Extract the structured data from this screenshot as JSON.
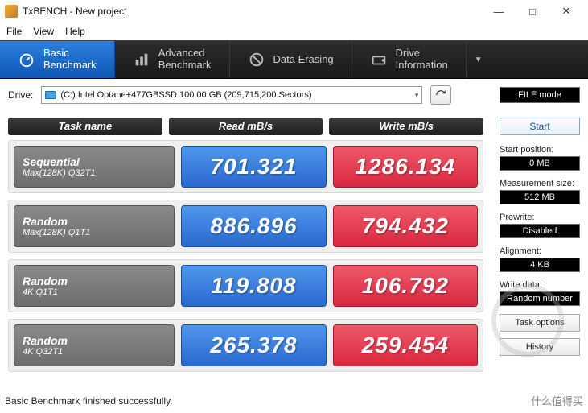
{
  "window": {
    "title": "TxBENCH - New project"
  },
  "menu": {
    "file": "File",
    "view": "View",
    "help": "Help"
  },
  "toolbar": {
    "basic": {
      "l1": "Basic",
      "l2": "Benchmark"
    },
    "advanced": {
      "l1": "Advanced",
      "l2": "Benchmark"
    },
    "erase": {
      "l1": "Data Erasing"
    },
    "info": {
      "l1": "Drive",
      "l2": "Information"
    }
  },
  "drive": {
    "label": "Drive:",
    "selected": "(C:) Intel Optane+477GBSSD  100.00 GB (209,715,200 Sectors)",
    "filemode": "FILE mode"
  },
  "headers": {
    "task": "Task name",
    "read": "Read mB/s",
    "write": "Write mB/s"
  },
  "rows": [
    {
      "t1": "Sequential",
      "t2": "Max(128K) Q32T1",
      "read": "701.321",
      "write": "1286.134"
    },
    {
      "t1": "Random",
      "t2": "Max(128K) Q1T1",
      "read": "886.896",
      "write": "794.432"
    },
    {
      "t1": "Random",
      "t2": "4K Q1T1",
      "read": "119.808",
      "write": "106.792"
    },
    {
      "t1": "Random",
      "t2": "4K Q32T1",
      "read": "265.378",
      "write": "259.454"
    }
  ],
  "side": {
    "start": "Start",
    "startpos_l": "Start position:",
    "startpos_v": "0 MB",
    "meas_l": "Measurement size:",
    "meas_v": "512 MB",
    "prewrite_l": "Prewrite:",
    "prewrite_v": "Disabled",
    "align_l": "Alignment:",
    "align_v": "4 KB",
    "wdata_l": "Write data:",
    "wdata_v": "Random number",
    "taskopt": "Task options",
    "history": "History"
  },
  "status": "Basic Benchmark finished successfully.",
  "watermark": "什么值得买"
}
